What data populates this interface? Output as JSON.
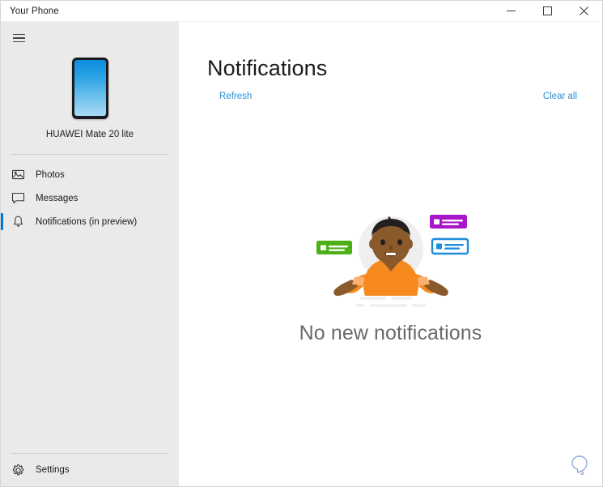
{
  "window": {
    "title": "Your Phone",
    "controls": {
      "minimize": "Minimize",
      "maximize": "Maximize",
      "close": "Close"
    }
  },
  "sidebar": {
    "menu_button": "hamburger-menu",
    "device": {
      "name": "HUAWEI Mate 20 lite",
      "icon": "phone-icon"
    },
    "items": [
      {
        "label": "Photos",
        "icon": "photos-icon",
        "selected": false
      },
      {
        "label": "Messages",
        "icon": "messages-icon",
        "selected": false
      },
      {
        "label": "Notifications (in preview)",
        "icon": "bell-icon",
        "selected": true
      }
    ],
    "settings": {
      "label": "Settings",
      "icon": "gear-icon"
    },
    "accent_color": "#0078d7",
    "background_color": "#eaeaea"
  },
  "main": {
    "title": "Notifications",
    "refresh_label": "Refresh",
    "clear_all_label": "Clear all",
    "link_color": "#2a8fd4",
    "empty_state": {
      "message": "No new notifications",
      "illustration": "shrugging-person-illustration",
      "card_colors": {
        "green": "#4caf16",
        "purple": "#a915c9",
        "blue": "#1b8ddb"
      },
      "shirt_color": "#f78a1e",
      "skin_color": "#8b5a2b",
      "hair_color": "#231f20"
    }
  },
  "feedback": {
    "label": "Feedback",
    "icon": "feedback-bulb-icon",
    "color": "#8fa8d8"
  }
}
